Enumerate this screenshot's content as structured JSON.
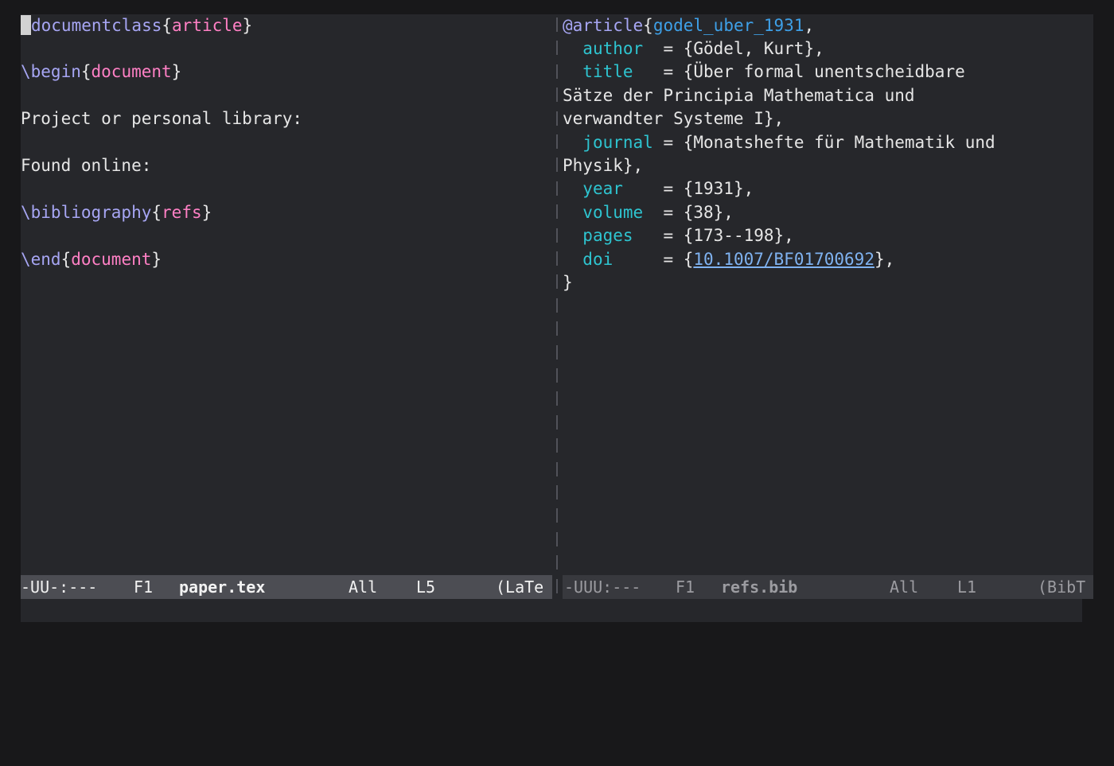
{
  "left": {
    "l1": {
      "cmd": "documentclass",
      "open": "{",
      "arg": "article",
      "close": "}"
    },
    "l3": {
      "cmd": "\\begin",
      "open": "{",
      "arg": "document",
      "close": "}"
    },
    "l5": "Project or personal library:",
    "l7": "Found online:",
    "l9": {
      "cmd": "\\bibliography",
      "open": "{",
      "arg": "refs",
      "close": "}"
    },
    "l11": {
      "cmd": "\\end",
      "open": "{",
      "arg": "document",
      "close": "}"
    }
  },
  "right": {
    "l1": {
      "type": "@article",
      "open": "{",
      "key": "godel_uber_1931",
      "comma": ","
    },
    "author": {
      "indent": "  ",
      "field": "author",
      "rest": "  = {Gödel, Kurt},"
    },
    "title": {
      "indent": "  ",
      "field": "title",
      "rest": "   = {Über formal unentscheidbare"
    },
    "title_cont1": "Sätze der Principia Mathematica und",
    "title_cont2": "verwandter Systeme I},",
    "journal": {
      "indent": "  ",
      "field": "journal",
      "rest": " = {Monatshefte für Mathematik und"
    },
    "journal_cont": "Physik},",
    "year": {
      "indent": "  ",
      "field": "year",
      "rest": "    = {1931},"
    },
    "volume": {
      "indent": "  ",
      "field": "volume",
      "rest": "  = {38},"
    },
    "pages": {
      "indent": "  ",
      "field": "pages",
      "rest": "   = {173--198},"
    },
    "doi": {
      "indent": "  ",
      "field": "doi",
      "mid": "     = {",
      "value": "10.1007/BF01700692",
      "end": "},"
    },
    "close": "}"
  },
  "modeline_left": {
    "status": "-UU-:---",
    "frame": "F1",
    "buffer": "paper.tex",
    "position": "All",
    "line": "L5",
    "mode": "(LaTe"
  },
  "modeline_right": {
    "status": "-UUU:---",
    "frame": "F1",
    "buffer": "refs.bib",
    "position": "All",
    "line": "L1",
    "mode": "(BibT"
  },
  "colors": {
    "background": "#26272b",
    "command": "#a7a6f4",
    "argument": "#ff80c5",
    "field": "#2ec4d0",
    "key": "#3ea0e8",
    "link": "#7fb2f0",
    "modeline_active": "#4c4d53",
    "modeline_inactive": "#38393e"
  }
}
